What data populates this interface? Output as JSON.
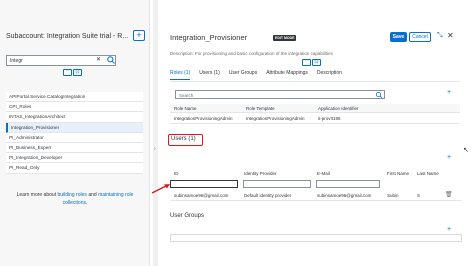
{
  "left": {
    "header": "Subaccount: Integration Suite trial - R...",
    "add_label": "+",
    "search_value": "Integr",
    "clear_label": "✕",
    "roles": [
      "APIPortal.Service.CatalogIntegration",
      "CPI_Roles",
      "INTAS_IntegrationArchitect",
      "Integration_Provisioner",
      "PI_Administrator",
      "PI_Business_Expert",
      "PI_Integration_Developer",
      "PI_Read_Only"
    ],
    "selected_index": 3,
    "info_prefix": "Learn more about ",
    "info_link1": "building roles",
    "info_mid": " and ",
    "info_link2": "maintaining role collections",
    "info_suffix": "."
  },
  "detail": {
    "title": "Integration_Provisioner",
    "badge": "EDIT MODE",
    "save": "Save",
    "cancel": "Cancel",
    "description": "Description: For provisioning and basic configuration of the integration capabilities",
    "tabs": [
      "Roles (1)",
      "Users (1)",
      "User Groups",
      "Attribute Mappings",
      "Description"
    ],
    "roles_search_placeholder": "Search",
    "roles_columns": [
      "Role Name",
      "Role Template",
      "Application Identifier"
    ],
    "roles_rows": [
      [
        "IntegrationProvisioningAdmin",
        "IntegrationProvisioningAdmin",
        "it-prov!t196"
      ]
    ],
    "users_heading": "Users (1)",
    "users_columns": [
      "ID",
      "Identity Provider",
      "E-Mail",
      "First Name",
      "Last Name"
    ],
    "users_rows": [
      [
        "subinsamoe96@gmail.com",
        "Default identity provider",
        "subinsamoe96@gmail.com",
        "Subin",
        "S"
      ]
    ],
    "user_groups_heading": "User Groups"
  },
  "colors": {
    "accent": "#0a6ed1",
    "highlight_red": "#e0161b",
    "selected_bg": "#e5f0fa"
  }
}
